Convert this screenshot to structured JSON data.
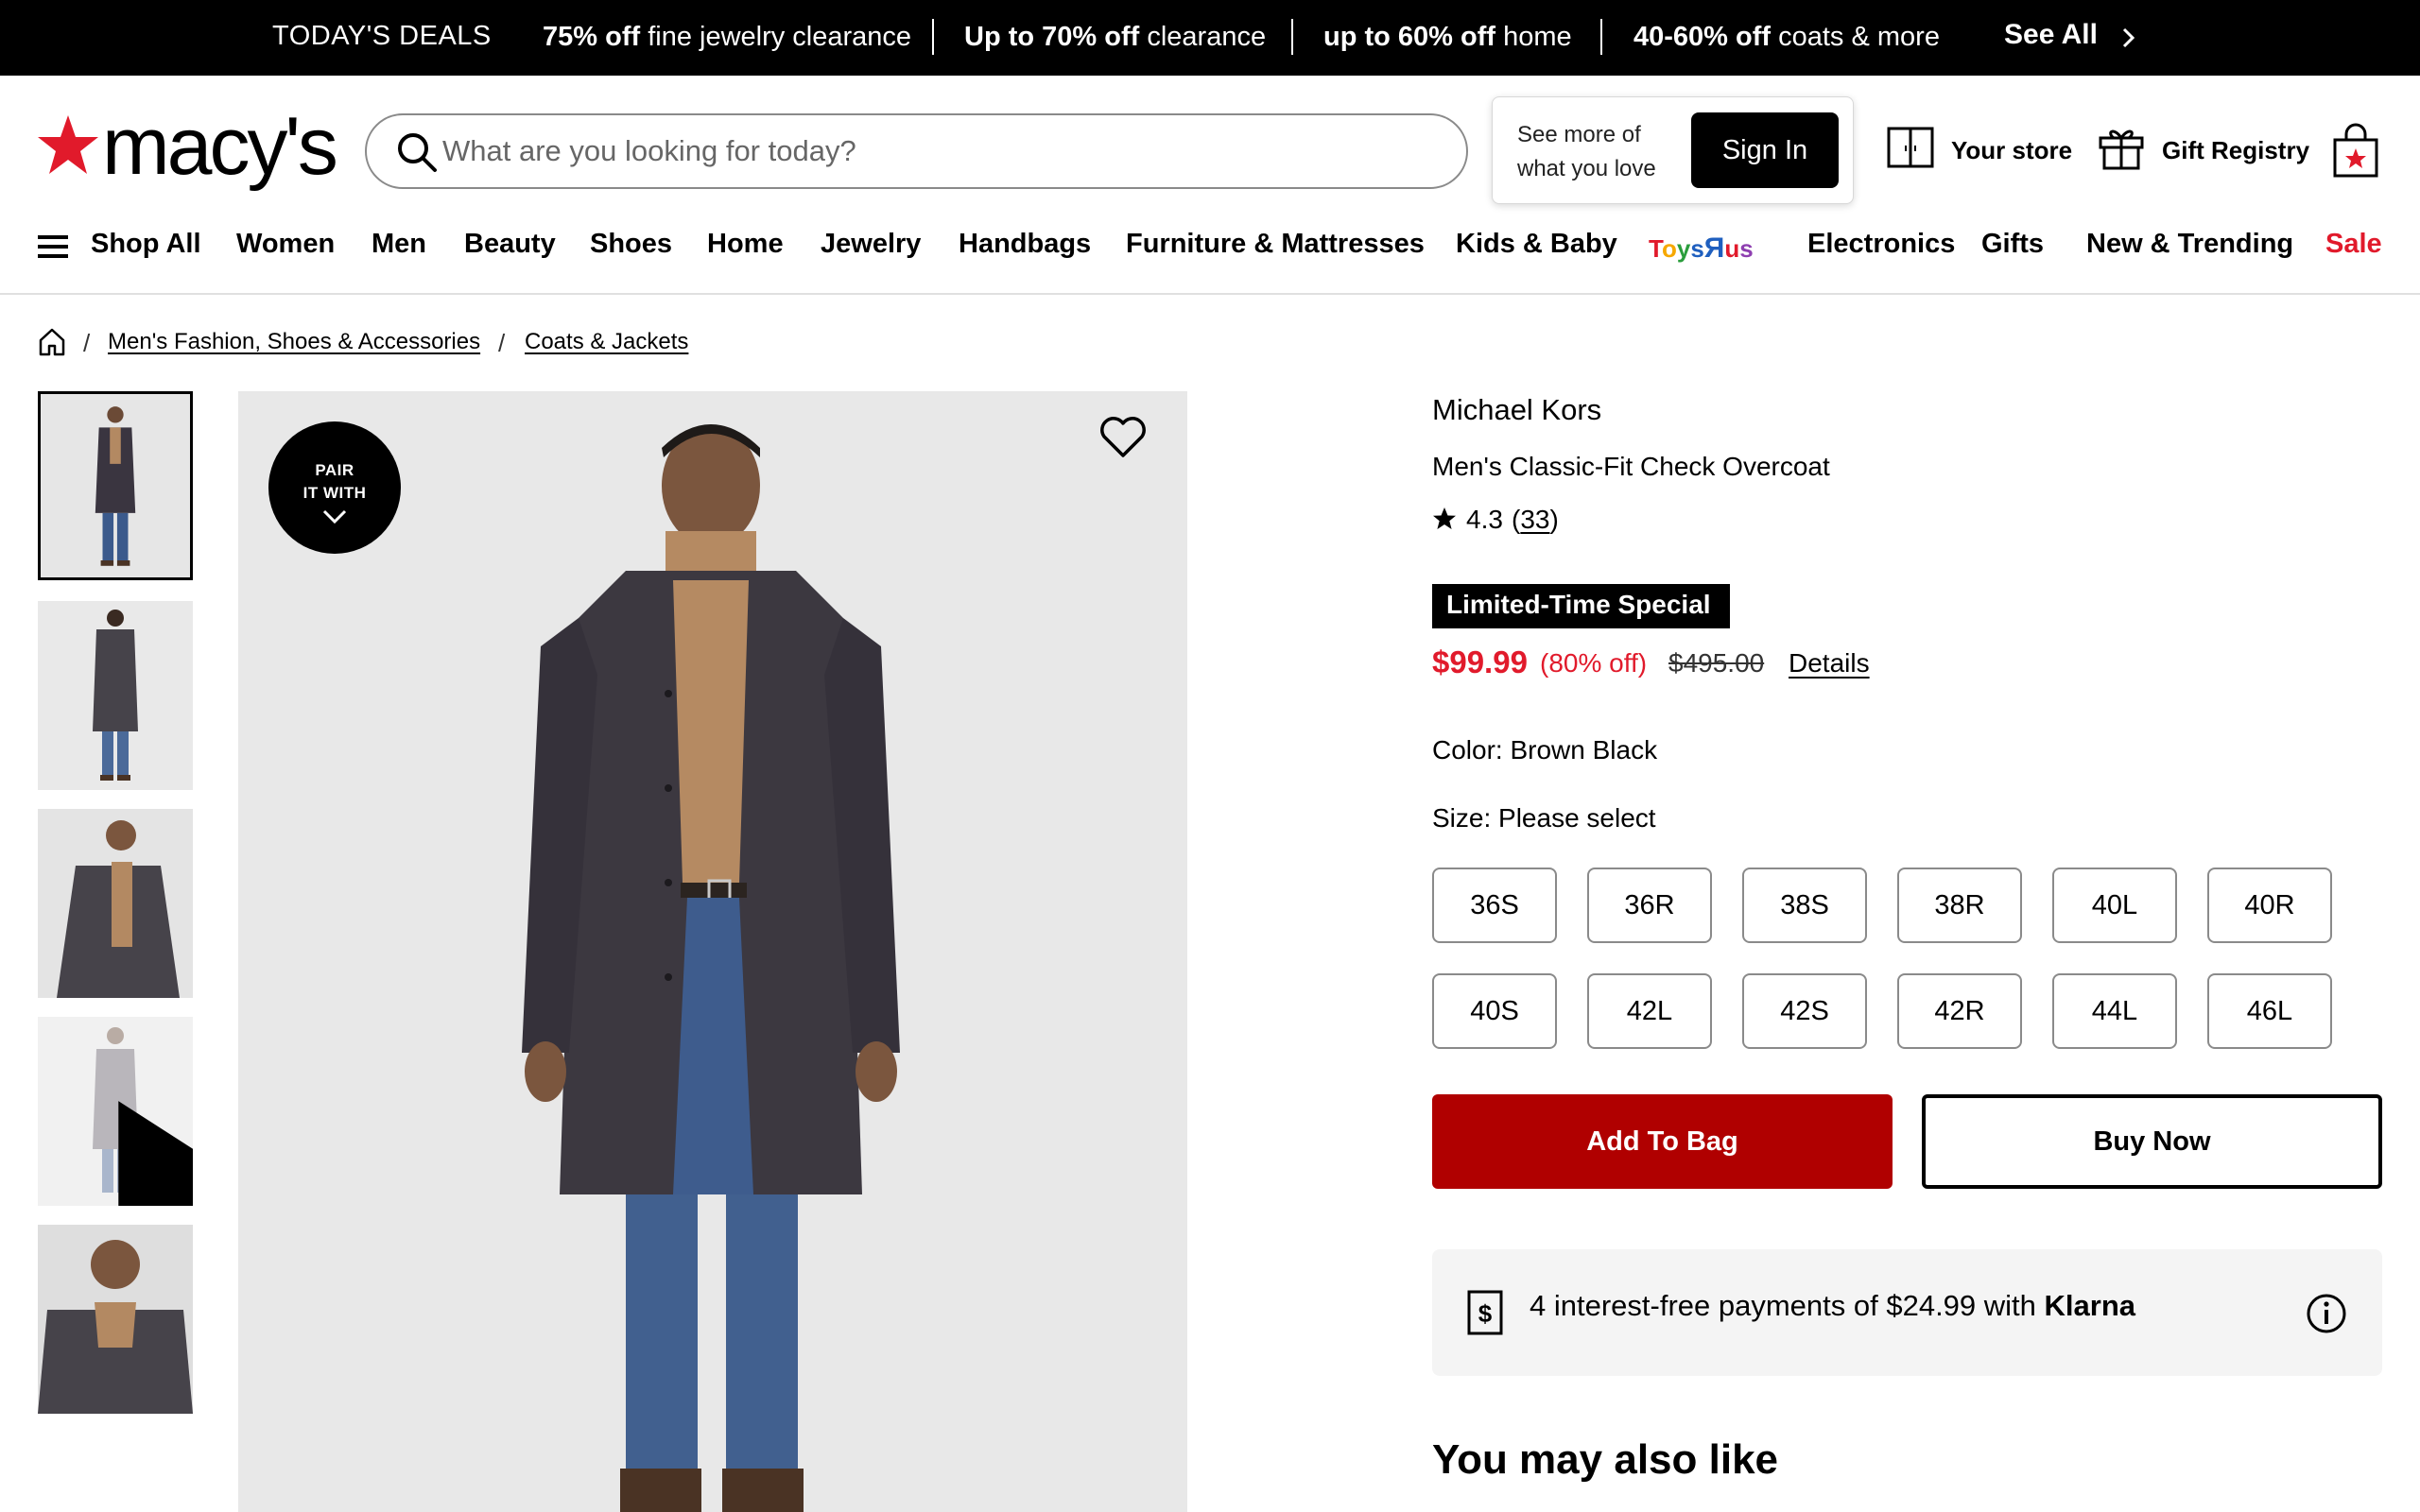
{
  "deals_bar": {
    "label": "TODAY'S DEALS",
    "deals": [
      {
        "bold": "75% off",
        "rest": " fine jewelry clearance"
      },
      {
        "bold": "Up to 70% off",
        "rest": " clearance"
      },
      {
        "bold": "up to 60% off",
        "rest": " home"
      },
      {
        "bold": "40-60% off",
        "rest": " coats & more"
      }
    ],
    "see_all": "See All"
  },
  "header": {
    "logo_text": "macy's",
    "search": {
      "placeholder": "What are you looking for today?"
    },
    "signin_prompt": "See more of what you love",
    "signin_button": "Sign In",
    "your_store": "Your store",
    "gift_registry": "Gift Registry"
  },
  "nav": {
    "shop_all": "Shop All",
    "items": [
      "Women",
      "Men",
      "Beauty",
      "Shoes",
      "Home",
      "Jewelry",
      "Handbags",
      "Furniture & Mattresses",
      "Kids & Baby",
      "Electronics",
      "Gifts",
      "New & Trending",
      "Sale"
    ],
    "toysrus_logo": "ToysRus"
  },
  "breadcrumb": [
    "Men's Fashion, Shoes & Accessories",
    "Coats & Jackets"
  ],
  "gallery": {
    "pair_badge": [
      "PAIR",
      "IT WITH"
    ],
    "thumbnails": [
      "front-full",
      "back-full",
      "side-closeup",
      "video",
      "collar-closeup"
    ]
  },
  "product": {
    "brand": "Michael Kors",
    "name": "Men's Classic-Fit Check Overcoat",
    "rating": "4.3",
    "review_count": "33",
    "badge": "Limited-Time Special",
    "sale_price": "$99.99",
    "percent_off": "(80% off)",
    "original_price": "$495.00",
    "details_link": "Details",
    "color_label": "Color: Brown Black",
    "size_label": "Size: Please select",
    "sizes": [
      "36S",
      "36R",
      "38S",
      "38R",
      "40L",
      "40R",
      "40S",
      "42L",
      "42S",
      "42R",
      "44L",
      "46L"
    ],
    "add_to_bag": "Add To Bag",
    "buy_now": "Buy Now"
  },
  "klarna": {
    "text": "4 interest-free payments of $24.99 with ",
    "brand": "Klarna"
  },
  "also_like": "You may also like",
  "colors": {
    "brand_red": "#e11a2b",
    "add_to_bag": "#b00000"
  }
}
